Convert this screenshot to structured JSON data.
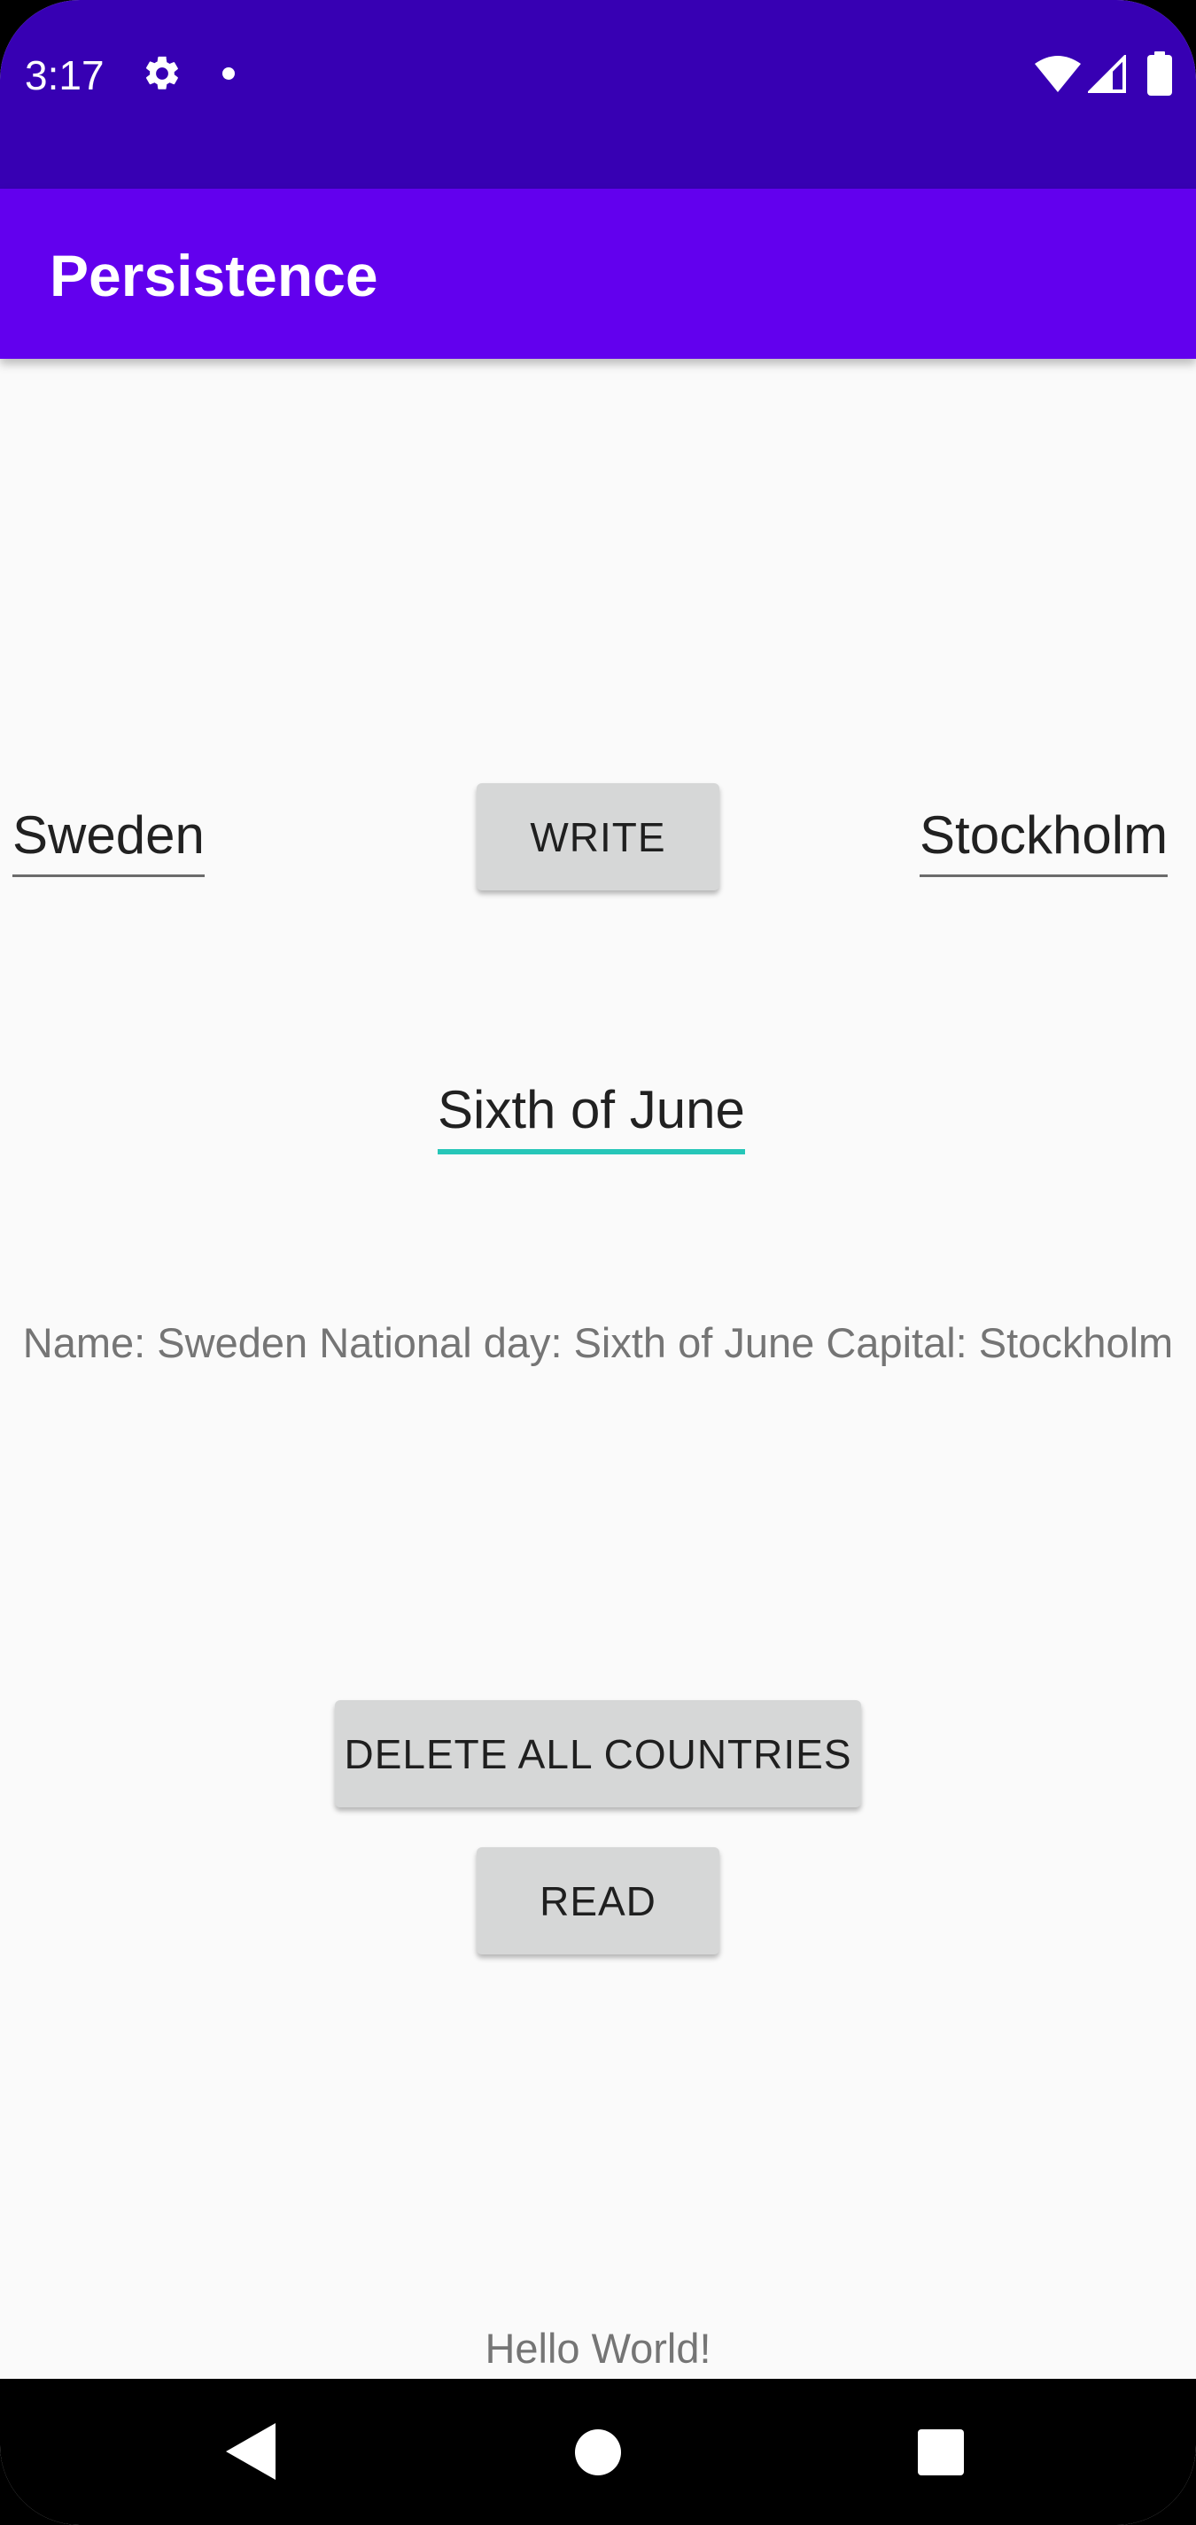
{
  "status_bar": {
    "time": "3:17",
    "icons": [
      "gear-icon",
      "notification-dot-icon",
      "wifi-icon",
      "signal-icon",
      "battery-icon"
    ],
    "color": "#3700b3"
  },
  "app_bar": {
    "title": "Persistence",
    "color": "#6200ee"
  },
  "form": {
    "country_value": "Sweden",
    "capital_value": "Stockholm",
    "national_day_value": "Sixth of June",
    "write_label": "WRITE",
    "focus_color": "#26c6b8"
  },
  "result": {
    "text": "Name: Sweden National day: Sixth of June Capital: Stockholm"
  },
  "actions": {
    "delete_label": "DELETE ALL COUNTRIES",
    "read_label": "READ"
  },
  "footer": {
    "hello_text": "Hello World!"
  },
  "nav_bar": {
    "icons": [
      "back-icon",
      "home-icon",
      "recents-icon"
    ]
  }
}
